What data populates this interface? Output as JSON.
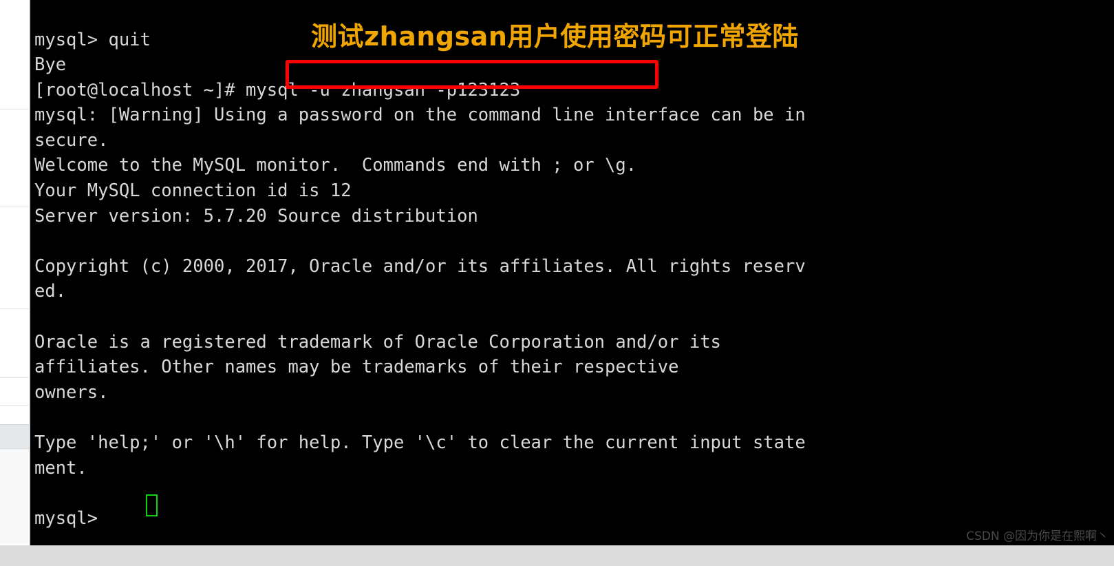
{
  "terminal": {
    "background_color": "#000000",
    "text_color": "#d8d8d8",
    "lines": [
      "mysql> quit",
      "Bye",
      "[root@localhost ~]# mysql -u zhangsan -p123123",
      "mysql: [Warning] Using a password on the command line interface can be in",
      "secure.",
      "Welcome to the MySQL monitor.  Commands end with ; or \\g.",
      "Your MySQL connection id is 12",
      "Server version: 5.7.20 Source distribution",
      "",
      "Copyright (c) 2000, 2017, Oracle and/or its affiliates. All rights reserv",
      "ed.",
      "",
      "Oracle is a registered trademark of Oracle Corporation and/or its",
      "affiliates. Other names may be trademarks of their respective",
      "owners.",
      "",
      "Type 'help;' or '\\h' for help. Type '\\c' to clear the current input state",
      "ment.",
      "",
      "mysql> "
    ],
    "prompt": "mysql> ",
    "cursor_color": "#12d012"
  },
  "annotation": {
    "text": "测试zhangsan用户使用密码可正常登陆",
    "color": "#f0a500"
  },
  "highlight_box": {
    "color": "#fd0000",
    "target_command": "mysql -u zhangsan -p123123"
  },
  "watermark": {
    "text": "CSDN @因为你是在熙啊丶",
    "color": "#4a4a4a"
  }
}
